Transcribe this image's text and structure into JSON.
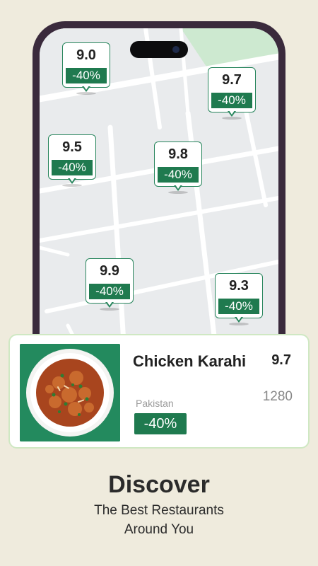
{
  "map_pins": [
    {
      "score": "9.0",
      "discount": "-40%"
    },
    {
      "score": "9.7",
      "discount": "-40%"
    },
    {
      "score": "9.5",
      "discount": "-40%"
    },
    {
      "score": "9.8",
      "discount": "-40%"
    },
    {
      "score": "9.9",
      "discount": "-40%"
    },
    {
      "score": "9.3",
      "discount": "-40%"
    }
  ],
  "restaurant_card": {
    "dish_name": "Chicken Karahi",
    "score": "9.7",
    "count": "1280",
    "country": "Pakistan",
    "discount": "-40%"
  },
  "headline": "Discover",
  "subtitle_line1": "The Best Restaurants",
  "subtitle_line2": "Around You",
  "colors": {
    "accent_green": "#1f7a4f",
    "background": "#efebdd",
    "phone_frame": "#3a2a3c"
  }
}
